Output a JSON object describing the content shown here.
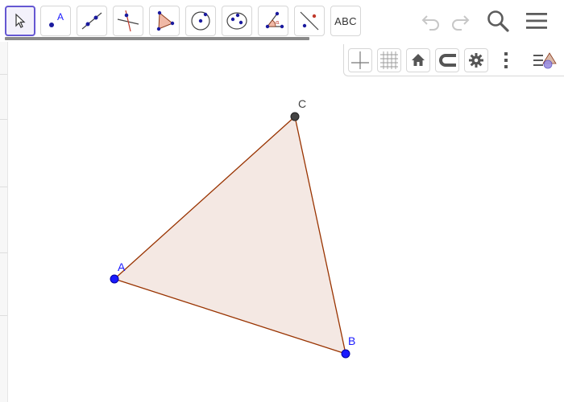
{
  "toolbar": {
    "tools": [
      {
        "name": "move-tool",
        "icon": "pointer-arrow-icon",
        "selected": true
      },
      {
        "name": "point-tool",
        "icon": "point-icon",
        "label": "A"
      },
      {
        "name": "line-tool",
        "icon": "line-through-points-icon"
      },
      {
        "name": "perpendicular-line-tool",
        "icon": "perpendicular-line-icon"
      },
      {
        "name": "polygon-tool",
        "icon": "polygon-icon"
      },
      {
        "name": "circle-tool",
        "icon": "circle-center-point-icon"
      },
      {
        "name": "ellipse-tool",
        "icon": "ellipse-icon"
      },
      {
        "name": "angle-tool",
        "icon": "angle-icon"
      },
      {
        "name": "reflect-tool",
        "icon": "reflect-about-line-icon"
      },
      {
        "name": "text-tool",
        "icon": "text-icon",
        "label": "ABC"
      }
    ],
    "progress_percent": 54
  },
  "header_icons": [
    "undo-icon",
    "redo-icon",
    "search-icon",
    "menu-icon"
  ],
  "style_bar": {
    "buttons": [
      "axes-icon",
      "grid-icon",
      "home-icon",
      "magnet-icon",
      "gear-icon",
      "more-vertical-icon",
      "toggle-style-bar-icon"
    ]
  },
  "colors": {
    "accent": "#6557d2",
    "point_free": "#1a1aff",
    "point_dependent": "#444444",
    "polygon_fill": "#f4e8e3",
    "polygon_edge": "#993300",
    "icon_gray": "#5c5c5c",
    "disabled_gray": "#c7c7c7"
  },
  "triangle": {
    "points": [
      {
        "name": "A",
        "label": "A"
      },
      {
        "name": "B",
        "label": "B"
      },
      {
        "name": "C",
        "label": "C"
      }
    ]
  }
}
